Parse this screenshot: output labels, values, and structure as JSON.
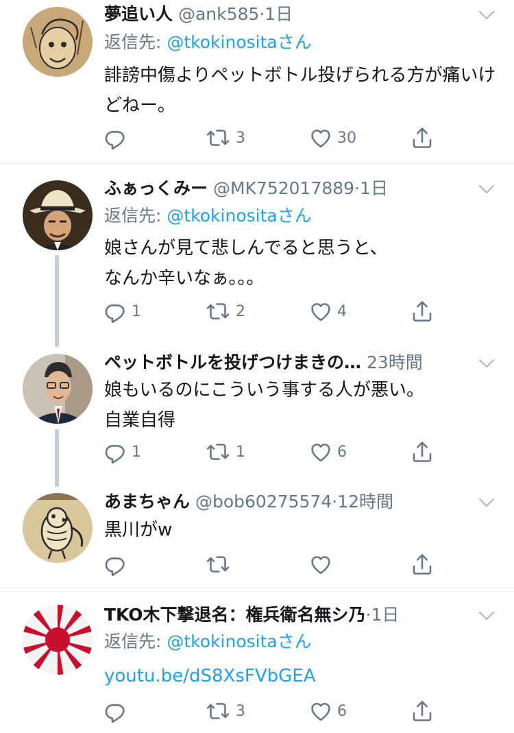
{
  "tweets": [
    {
      "name": "夢追い人",
      "handle": "@ank585",
      "dot": "·",
      "time": "1日",
      "reply_prefix": "返信先: ",
      "reply_to": "@tkokinosita",
      "reply_suffix": "さん",
      "text": "誹謗中傷よりペットボトル投げられる方が痛いけどねー。",
      "replies": "",
      "retweets": "3",
      "likes": "30"
    },
    {
      "name": "ふぁっくみー",
      "handle": "@MK752017889",
      "dot": "·",
      "time": "1日",
      "reply_prefix": "返信先: ",
      "reply_to": "@tkokinosita",
      "reply_suffix": "さん",
      "text_line1": "娘さんが見て悲しんでると思うと、",
      "text_line2": "なんか辛いなぁ。。。",
      "replies": "1",
      "retweets": "2",
      "likes": "4"
    },
    {
      "name": "ペットボトルを投げつけまきの…",
      "handle": "",
      "dot": "",
      "time": "23時間",
      "text_line1": "娘もいるのにこういう事する人が悪い。",
      "text_line2": "自業自得",
      "replies": "1",
      "retweets": "1",
      "likes": "6"
    },
    {
      "name": "あまちゃん",
      "handle": "@bob60275574",
      "dot": "·",
      "time": "12時間",
      "text": "黒川がw",
      "replies": "",
      "retweets": "",
      "likes": ""
    },
    {
      "name": "TKO木下撃退名：権兵衛名無シ乃",
      "handle": "",
      "dot": "·",
      "time": "1日",
      "reply_prefix": "返信先: ",
      "reply_to": "@tkokinosita",
      "reply_suffix": "さん",
      "link": "youtu.be/dS8XsFVbGEA",
      "replies": "",
      "retweets": "3",
      "likes": "6"
    }
  ],
  "colors": {
    "accent": "#1da1f2",
    "secondary": "#657786",
    "text": "#14171a",
    "divider": "#e1e8ed",
    "thread": "#c4cfd6"
  },
  "icons": [
    "reply-icon",
    "retweet-icon",
    "like-icon",
    "share-icon",
    "chevron-down-icon"
  ]
}
